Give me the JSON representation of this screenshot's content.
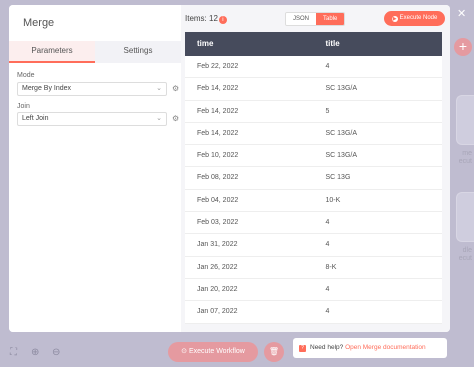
{
  "node": {
    "title": "Merge",
    "tabs": [
      "Parameters",
      "Settings"
    ],
    "active_tab": 0
  },
  "params": {
    "mode_label": "Mode",
    "mode_value": "Merge By Index",
    "join_label": "Join",
    "join_value": "Left Join"
  },
  "output": {
    "items_label": "Items:",
    "items_count": "12",
    "view_json": "JSON",
    "view_table": "Table",
    "execute_node": "Execute Node",
    "columns": [
      "time",
      "title"
    ],
    "rows": [
      [
        "Feb 22, 2022",
        "4"
      ],
      [
        "Feb 14, 2022",
        "SC 13G/A"
      ],
      [
        "Feb 14, 2022",
        "5"
      ],
      [
        "Feb 14, 2022",
        "SC 13G/A"
      ],
      [
        "Feb 10, 2022",
        "SC 13G/A"
      ],
      [
        "Feb 08, 2022",
        "SC 13G"
      ],
      [
        "Feb 04, 2022",
        "10-K"
      ],
      [
        "Feb 03, 2022",
        "4"
      ],
      [
        "Jan 31, 2022",
        "4"
      ],
      [
        "Jan 26, 2022",
        "8-K"
      ],
      [
        "Jan 20, 2022",
        "4"
      ],
      [
        "Jan 07, 2022",
        "4"
      ]
    ]
  },
  "canvas": {
    "execute_workflow": "Execute Workflow",
    "help_text": "Need help?",
    "help_link": "Open Merge documentation",
    "bg_label_1": "me",
    "bg_label_1b": "ecut",
    "bg_label_2": "dle",
    "bg_label_2b": "ecut"
  },
  "colors": {
    "accent": "#ff6d5a",
    "table_header": "#464b5c"
  }
}
